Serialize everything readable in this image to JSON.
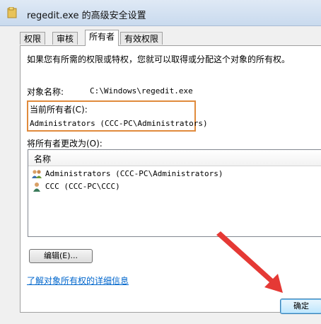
{
  "window": {
    "title": "regedit.exe 的高级安全设置"
  },
  "tabs": [
    {
      "label": "权限",
      "active": false
    },
    {
      "label": "审核",
      "active": false
    },
    {
      "label": "所有者",
      "active": true
    },
    {
      "label": "有效权限",
      "active": false
    }
  ],
  "owner": {
    "intro": "如果您有所需的权限或特权，您就可以取得或分配这个对象的所有权。",
    "object_name_label": "对象名称:",
    "object_name_value": "C:\\Windows\\regedit.exe",
    "current_owner_label": "当前所有者(C):",
    "current_owner_value": "Administrators (CCC-PC\\Administrators)",
    "change_owner_label": "将所有者更改为(O):",
    "list_header": "名称",
    "list_items": [
      {
        "name": "Administrators (CCC-PC\\Administrators)",
        "icon": "group-users-icon"
      },
      {
        "name": "CCC (CCC-PC\\CCC)",
        "icon": "user-icon"
      }
    ],
    "edit_button": "编辑(E)...",
    "learn_more_link": "了解对象所有权的详细信息"
  },
  "footer": {
    "ok_button": "确定"
  },
  "colors": {
    "highlight_box": "#e08a3c",
    "annotation_arrow": "#e53935",
    "link": "#0066cc"
  }
}
